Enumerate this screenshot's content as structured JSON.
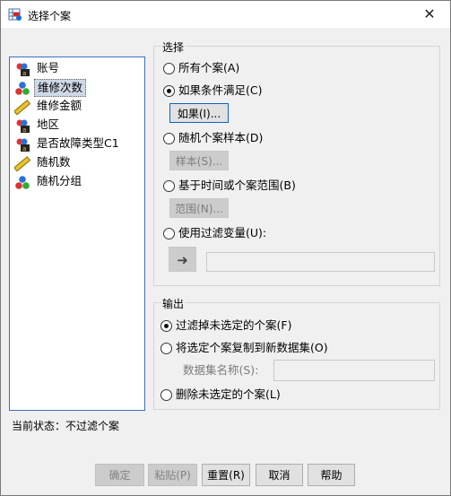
{
  "window": {
    "title": "选择个案",
    "close_glyph": "✕"
  },
  "variables": [
    {
      "label": "账号",
      "icon": "nominal-person-icon"
    },
    {
      "label": "维修次数",
      "icon": "nominal-balls-icon",
      "selected": true
    },
    {
      "label": "维修金额",
      "icon": "scale-ruler-icon"
    },
    {
      "label": "地区",
      "icon": "nominal-person-icon"
    },
    {
      "label": "是否故障类型C1",
      "icon": "nominal-person-icon"
    },
    {
      "label": "随机数",
      "icon": "scale-ruler-icon"
    },
    {
      "label": "随机分组",
      "icon": "nominal-balls-icon"
    }
  ],
  "status": "当前状态：不过滤个案",
  "select_group": {
    "title": "选择",
    "opt_all": "所有个案(A)",
    "opt_if": "如果条件满足(C)",
    "btn_if": "如果(I)...",
    "opt_random": "随机个案样本(D)",
    "btn_sample": "样本(S)...",
    "opt_range": "基于时间或个案范围(B)",
    "btn_range": "范围(N)...",
    "opt_filter": "使用过滤变量(U):",
    "arrow_glyph": "➜"
  },
  "output_group": {
    "title": "输出",
    "opt_filter_out": "过滤掉未选定的个案(F)",
    "opt_copy": "将选定个案复制到新数据集(O)",
    "dataset_label": "数据集名称(S):",
    "opt_delete": "删除未选定的个案(L)"
  },
  "footer": {
    "ok": "确定",
    "paste": "粘贴(P)",
    "reset": "重置(R)",
    "cancel": "取消",
    "help": "帮助"
  }
}
